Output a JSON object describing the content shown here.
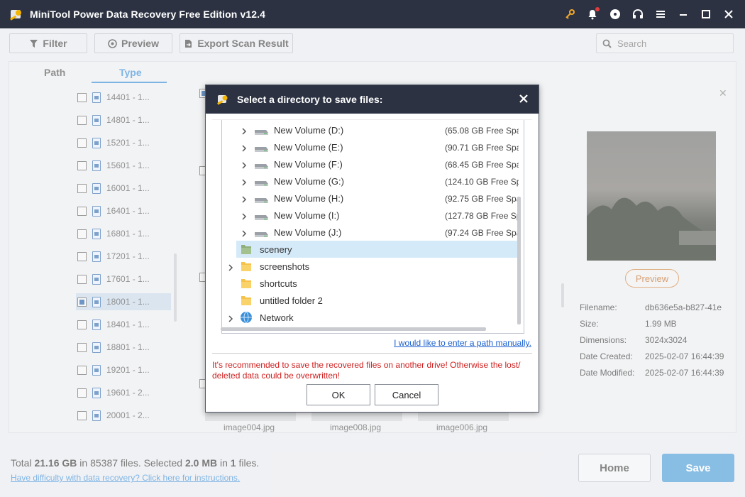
{
  "window": {
    "title": "MiniTool Power Data Recovery Free Edition v12.4"
  },
  "toolbar": {
    "filter_label": "Filter",
    "preview_label": "Preview",
    "export_label": "Export Scan Result"
  },
  "search": {
    "placeholder": "Search"
  },
  "left_tabs": {
    "path_label": "Path",
    "type_label": "Type"
  },
  "tree_items": [
    {
      "label": "14401 - 1..."
    },
    {
      "label": "14801 - 1..."
    },
    {
      "label": "15201 - 1..."
    },
    {
      "label": "15601 - 1..."
    },
    {
      "label": "16001 - 1..."
    },
    {
      "label": "16401 - 1..."
    },
    {
      "label": "16801 - 1..."
    },
    {
      "label": "17201 - 1..."
    },
    {
      "label": "17601 - 1..."
    },
    {
      "label": "18001 - 1...",
      "selected": true
    },
    {
      "label": "18401 - 1..."
    },
    {
      "label": "18801 - 1..."
    },
    {
      "label": "19201 - 1..."
    },
    {
      "label": "19601 - 2..."
    },
    {
      "label": "20001 - 2..."
    }
  ],
  "thumbnails": [
    "image004.jpg",
    "image008.jpg",
    "image006.jpg"
  ],
  "preview_panel": {
    "preview_label": "Preview",
    "filename_key": "Filename:",
    "filename": "db636e5a-b827-41e",
    "size_key": "Size:",
    "size": "1.99 MB",
    "dimensions_key": "Dimensions:",
    "dimensions": "3024x3024",
    "created_key": "Date Created:",
    "created": "2025-02-07 16:44:39",
    "modified_key": "Date Modified:",
    "modified": "2025-02-07 16:44:39"
  },
  "bottom": {
    "total_prefix": "Total ",
    "total_size": "21.16 GB",
    "in": " in ",
    "total_files": "85387",
    "files_selected": " files.  Selected ",
    "sel_size": "2.0 MB",
    "in2": " in ",
    "sel_count": "1",
    "files_end": " files.",
    "help_link": "Have difficulty with data recovery? Click here for instructions.",
    "home_label": "Home",
    "save_label": "Save"
  },
  "dialog": {
    "title": "Select a directory to save files:",
    "drives": [
      {
        "name": "New Volume (D:)",
        "free": "(65.08 GB Free Spa"
      },
      {
        "name": "New Volume (E:)",
        "free": "(90.71 GB Free Spa"
      },
      {
        "name": "New Volume (F:)",
        "free": "(68.45 GB Free Spa"
      },
      {
        "name": "New Volume (G:)",
        "free": "(124.10 GB Free Sp"
      },
      {
        "name": "New Volume (H:)",
        "free": "(92.75 GB Free Spa"
      },
      {
        "name": "New Volume (I:)",
        "free": "(127.78 GB Free Sp"
      },
      {
        "name": "New Volume (J:)",
        "free": "(97.24 GB Free Spa"
      }
    ],
    "folders": [
      {
        "name": "scenery",
        "selected": true,
        "expandable": false
      },
      {
        "name": "screenshots",
        "expandable": true
      },
      {
        "name": "shortcuts",
        "expandable": false
      },
      {
        "name": "untitled folder 2",
        "expandable": false
      }
    ],
    "network_label": "Network",
    "manual_link": "I would like to enter a path manually.",
    "warning": "It's recommended to save the recovered files on another drive! Otherwise the lost/ deleted data could be overwritten!",
    "ok_label": "OK",
    "cancel_label": "Cancel"
  },
  "colors": {
    "titlebar": "#2c3242",
    "accent": "#3a8dd6",
    "save_button": "#4a9bd6",
    "warning": "#d02020",
    "selected_row": "#d5eaf8"
  }
}
